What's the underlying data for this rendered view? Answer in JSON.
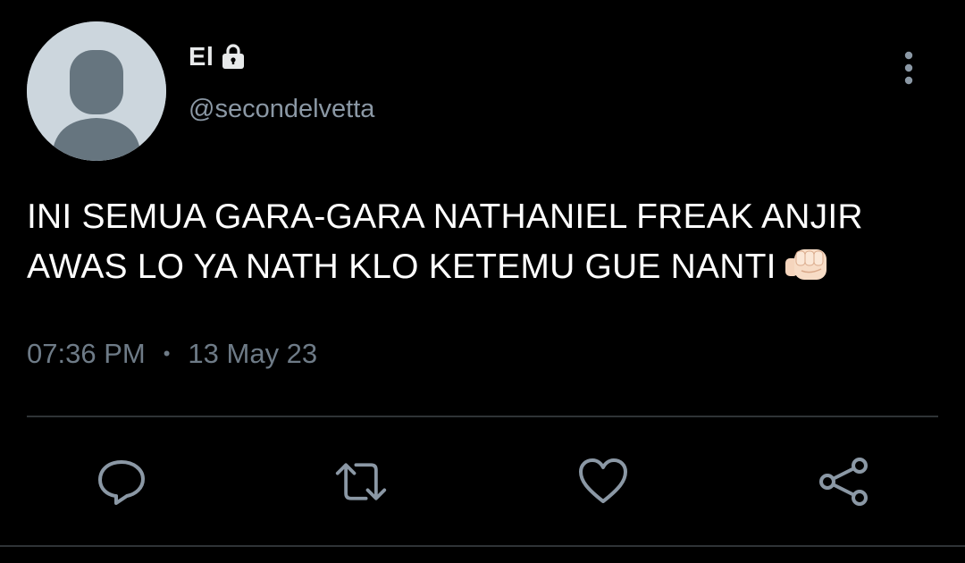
{
  "author": {
    "display_name": "El",
    "handle": "@secondelvetta",
    "protected": true
  },
  "tweet": {
    "lines": [
      "INI SEMUA GARA-GARA NATHANIEL FREAK ANJIR",
      "AWAS LO YA NATH KLO KETEMU GUE NANTI"
    ],
    "emoji": "oncoming-fist"
  },
  "meta": {
    "time": "07:36 PM",
    "separator": "•",
    "date": "13 May 23"
  },
  "actions": [
    {
      "name": "reply",
      "icon": "reply-icon"
    },
    {
      "name": "retweet",
      "icon": "retweet-icon"
    },
    {
      "name": "like",
      "icon": "heart-icon"
    },
    {
      "name": "share",
      "icon": "share-icon"
    }
  ],
  "colors": {
    "background": "#000000",
    "text": "#ffffff",
    "secondary": "#8b98a5",
    "icon": "#8b98a5",
    "divider": "#2f3336",
    "avatar_bg": "#ccd6dd",
    "avatar_fg": "#66757f"
  }
}
